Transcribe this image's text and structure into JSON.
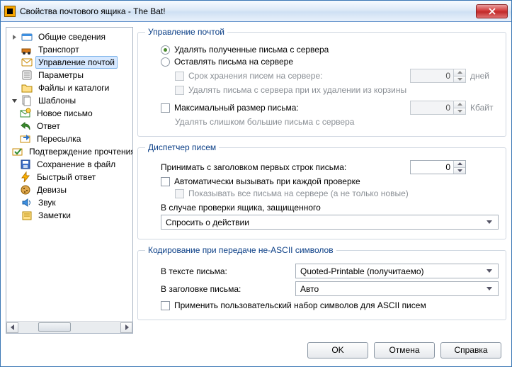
{
  "window": {
    "title": "Свойства почтового ящика - The Bat!"
  },
  "tree": {
    "general": "Общие сведения",
    "transport": "Транспорт",
    "mailmgmt": "Управление почтой",
    "params": "Параметры",
    "files": "Файлы и каталоги",
    "templates": "Шаблоны",
    "tpl_new": "Новое письмо",
    "tpl_reply": "Ответ",
    "tpl_forward": "Пересылка",
    "tpl_confirm": "Подтверждение прочтения",
    "tpl_save": "Сохранение в файл",
    "tpl_quick": "Быстрый ответ",
    "tpl_cookies": "Девизы",
    "sound": "Звук",
    "notes": "Заметки"
  },
  "g1": {
    "legend": "Управление почтой",
    "opt_delete": "Удалять полученные письма с сервера",
    "opt_leave": "Оставлять письма на сервере",
    "keep_days_lbl": "Срок хранения писем на сервере:",
    "keep_days_val": "0",
    "keep_days_unit": "дней",
    "del_on_trash": "Удалять письма с сервера при их удалении из корзины",
    "max_size_lbl": "Максимальный размер письма:",
    "max_size_val": "0",
    "max_size_unit": "Кбайт",
    "del_large": "Удалять слишком большие письма с сервера"
  },
  "g2": {
    "legend": "Диспетчер писем",
    "header_lines_lbl": "Принимать с заголовком первых строк письма:",
    "header_lines_val": "0",
    "auto_invoke": "Автоматически вызывать при каждой проверке",
    "show_all": "Показывать все письма на сервере (а не только новые)",
    "protected_lbl": "В случае проверки ящика, защищенного",
    "protected_sel": "Спросить о действии"
  },
  "g3": {
    "legend": "Кодирование при передаче не-ASCII символов",
    "body_lbl": "В тексте письма:",
    "body_sel": "Quoted-Printable (получитаемо)",
    "header_lbl": "В заголовке письма:",
    "header_sel": "Авто",
    "apply_ascii": "Применить пользовательский набор символов для ASCII писем"
  },
  "footer": {
    "ok": "OK",
    "cancel": "Отмена",
    "help": "Справка"
  }
}
